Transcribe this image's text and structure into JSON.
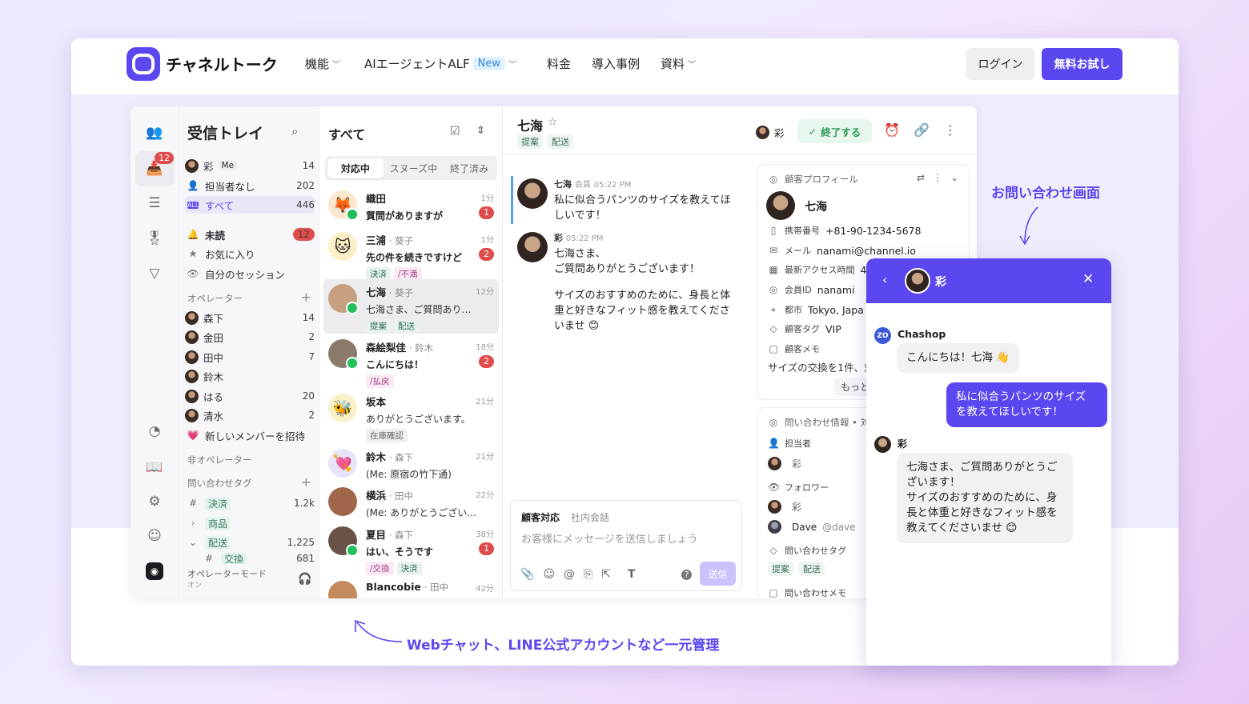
{
  "header": {
    "brand": "チャネルトーク",
    "nav": [
      {
        "label": "機能",
        "dropdown": true
      },
      {
        "label": "AIエージェントALF",
        "badge": "New",
        "dropdown": true
      },
      {
        "label": "料金"
      },
      {
        "label": "導入事例"
      },
      {
        "label": "資料",
        "dropdown": true
      }
    ],
    "login": "ログイン",
    "trial": "無料お試し"
  },
  "rail": {
    "badge": "12"
  },
  "inbox": {
    "title": "受信トレイ",
    "rows": [
      {
        "label": "彩",
        "me": "Me",
        "count": "14"
      },
      {
        "label": "担当者なし",
        "count": "202"
      },
      {
        "label": "すべて",
        "count": "446"
      }
    ],
    "rows2": [
      {
        "label": "未読",
        "count": "12"
      },
      {
        "label": "お気に入り"
      },
      {
        "label": "自分のセッション"
      }
    ],
    "operators_title": "オペレーター",
    "operators": [
      {
        "name": "森下",
        "count": "14"
      },
      {
        "name": "金田",
        "count": "2"
      },
      {
        "name": "田中",
        "count": "7"
      },
      {
        "name": "鈴木",
        "count": ""
      },
      {
        "name": "はる",
        "count": "20"
      },
      {
        "name": "清水",
        "count": "2"
      }
    ],
    "invite": "新しいメンバーを招待",
    "non_operator": "非オペレーター",
    "tags_title": "問い合わせタグ",
    "tags": [
      {
        "name": "決済",
        "count": "1.2k"
      },
      {
        "name": "商品",
        "count": ""
      },
      {
        "name": "配送",
        "count": "1,225"
      },
      {
        "name": "交換",
        "count": "681"
      }
    ],
    "operator_mode": "オペレーターモード",
    "operator_mode_state": "オン"
  },
  "list": {
    "title": "すべて",
    "tabs": [
      "対応中",
      "スヌーズ中",
      "終了済み"
    ],
    "items": [
      {
        "name": "織田",
        "sub": "",
        "time": "1分",
        "msg": "質問がありますが",
        "bold": true,
        "badge": "1",
        "tags": [],
        "icon": "🦊",
        "bg": "#fde7cf",
        "line": true
      },
      {
        "name": "三浦",
        "sub": "· 葵子",
        "time": "1分",
        "msg": "先の件を続きですけど",
        "bold": true,
        "badge": "2",
        "tags": [
          {
            "t": "決済",
            "c": ""
          },
          {
            "t": "/不満",
            "c": "p"
          }
        ],
        "icon": "🐱",
        "bg": "#fdf0c6",
        "line": false
      },
      {
        "name": "七海",
        "sub": "· 葵子",
        "time": "12分",
        "msg": "七海さま、ご質問ありがと...",
        "bold": false,
        "badge": "",
        "tags": [
          {
            "t": "提案",
            "c": ""
          },
          {
            "t": "配送",
            "c": ""
          }
        ],
        "icon": "",
        "bg": "#c9a07f",
        "line": true
      },
      {
        "name": "森絵梨佳",
        "sub": "· 鈴木",
        "time": "18分",
        "msg": "こんにちは！",
        "bold": true,
        "badge": "2",
        "tags": [
          {
            "t": "/払戻",
            "c": "p"
          }
        ],
        "icon": "",
        "bg": "#8b7a6a",
        "line": true
      },
      {
        "name": "坂本",
        "sub": "",
        "time": "21分",
        "msg": "ありがとうございます。",
        "bold": false,
        "badge": "",
        "tags": [
          {
            "t": "在庫確認",
            "c": "g"
          }
        ],
        "icon": "🐝",
        "bg": "#fbf1c8",
        "line": false
      },
      {
        "name": "鈴木",
        "sub": "· 森下",
        "time": "21分",
        "msg": "(Me: 原宿の竹下通)",
        "bold": false,
        "badge": "",
        "tags": [],
        "icon": "💘",
        "bg": "#e8e4fb",
        "line": false
      },
      {
        "name": "横浜",
        "sub": "· 田中",
        "time": "22分",
        "msg": "(Me: ありがとうございます！)",
        "bold": false,
        "badge": "",
        "tags": [],
        "icon": "",
        "bg": "#a0664a",
        "line": false
      },
      {
        "name": "夏目",
        "sub": "· 森下",
        "time": "38分",
        "msg": "はい、そうです",
        "bold": true,
        "badge": "1",
        "tags": [
          {
            "t": "/交換",
            "c": "p"
          },
          {
            "t": "決済",
            "c": ""
          }
        ],
        "icon": "",
        "bg": "#6a5346",
        "line": true
      },
      {
        "name": "Blancobie",
        "sub": "· 田中",
        "time": "42分",
        "msg": "",
        "bold": false,
        "badge": "",
        "tags": [],
        "icon": "",
        "bg": "#c48a5c",
        "line": false
      }
    ]
  },
  "chat": {
    "name": "七海",
    "tags": [
      "提案",
      "配送"
    ],
    "assignee": "彩",
    "end_label": "終了する",
    "messages": [
      {
        "who": "七海",
        "role": "会員",
        "time": "05:22 PM",
        "text": [
          "私に似合うパンツのサイズを教えてほ",
          "しいです！"
        ]
      },
      {
        "who": "彩",
        "role": "",
        "time": "05:22 PM",
        "text": [
          "七海さま、",
          "ご質問ありがとうございます！",
          "",
          "サイズのおすすめのために、身長と体",
          "重と好きなフィット感を教えてくださ",
          "いませ 😊"
        ]
      }
    ],
    "composer": {
      "tab1": "顧客対応",
      "tab2": "社内会話",
      "placeholder": "お客様にメッセージを送信しましょう",
      "send": "送信"
    }
  },
  "profile": {
    "title": "顧客プロフィール",
    "name": "七海",
    "rows": [
      {
        "label": "携帯番号",
        "value": "+81-90-1234-5678"
      },
      {
        "label": "メール",
        "value": "nanami@channel.io"
      },
      {
        "label": "最新アクセス時間",
        "value": "4"
      },
      {
        "label": "会員ID",
        "value": "nanami"
      },
      {
        "label": "都市",
        "value": "Tokyo, Japa"
      },
      {
        "label": "顧客タグ",
        "value": "VIP"
      },
      {
        "label": "顧客メモ",
        "value": ""
      }
    ],
    "memo": "サイズの交換を1件、対",
    "more": "もっと"
  },
  "inquiry": {
    "title": "問い合わせ情報 • 対",
    "assignee_label": "担当者",
    "assignee": "彩",
    "follower_label": "フォロワー",
    "followers": [
      "彩",
      "Dave"
    ],
    "dave_handle": "@dave",
    "tags_label": "問い合わせタグ",
    "tags": [
      "提案",
      "配送"
    ],
    "memo_label": "問い合わせメモ"
  },
  "widget": {
    "agent": "彩",
    "shop_badge": "ZO",
    "shop": "Chashop",
    "greet": "こんにちは！七海 👋",
    "user_msg": [
      "私に似合うパンツのサイズ",
      "を教えてほしいです！"
    ],
    "reply_name": "彩",
    "reply": [
      "七海さま、ご質問ありがとうご",
      "ざいます！",
      "サイズのおすすめのために、身",
      "長と体重と好きなフィット感を",
      "教えてくださいませ 😊"
    ]
  },
  "annotations": {
    "right": "お問い合わせ画面",
    "bottom": "Webチャット、LINE公式アカウントなど一元管理"
  },
  "colors": {
    "accent": "#5b47f0",
    "red": "#e04b4b",
    "green": "#23c05a"
  }
}
